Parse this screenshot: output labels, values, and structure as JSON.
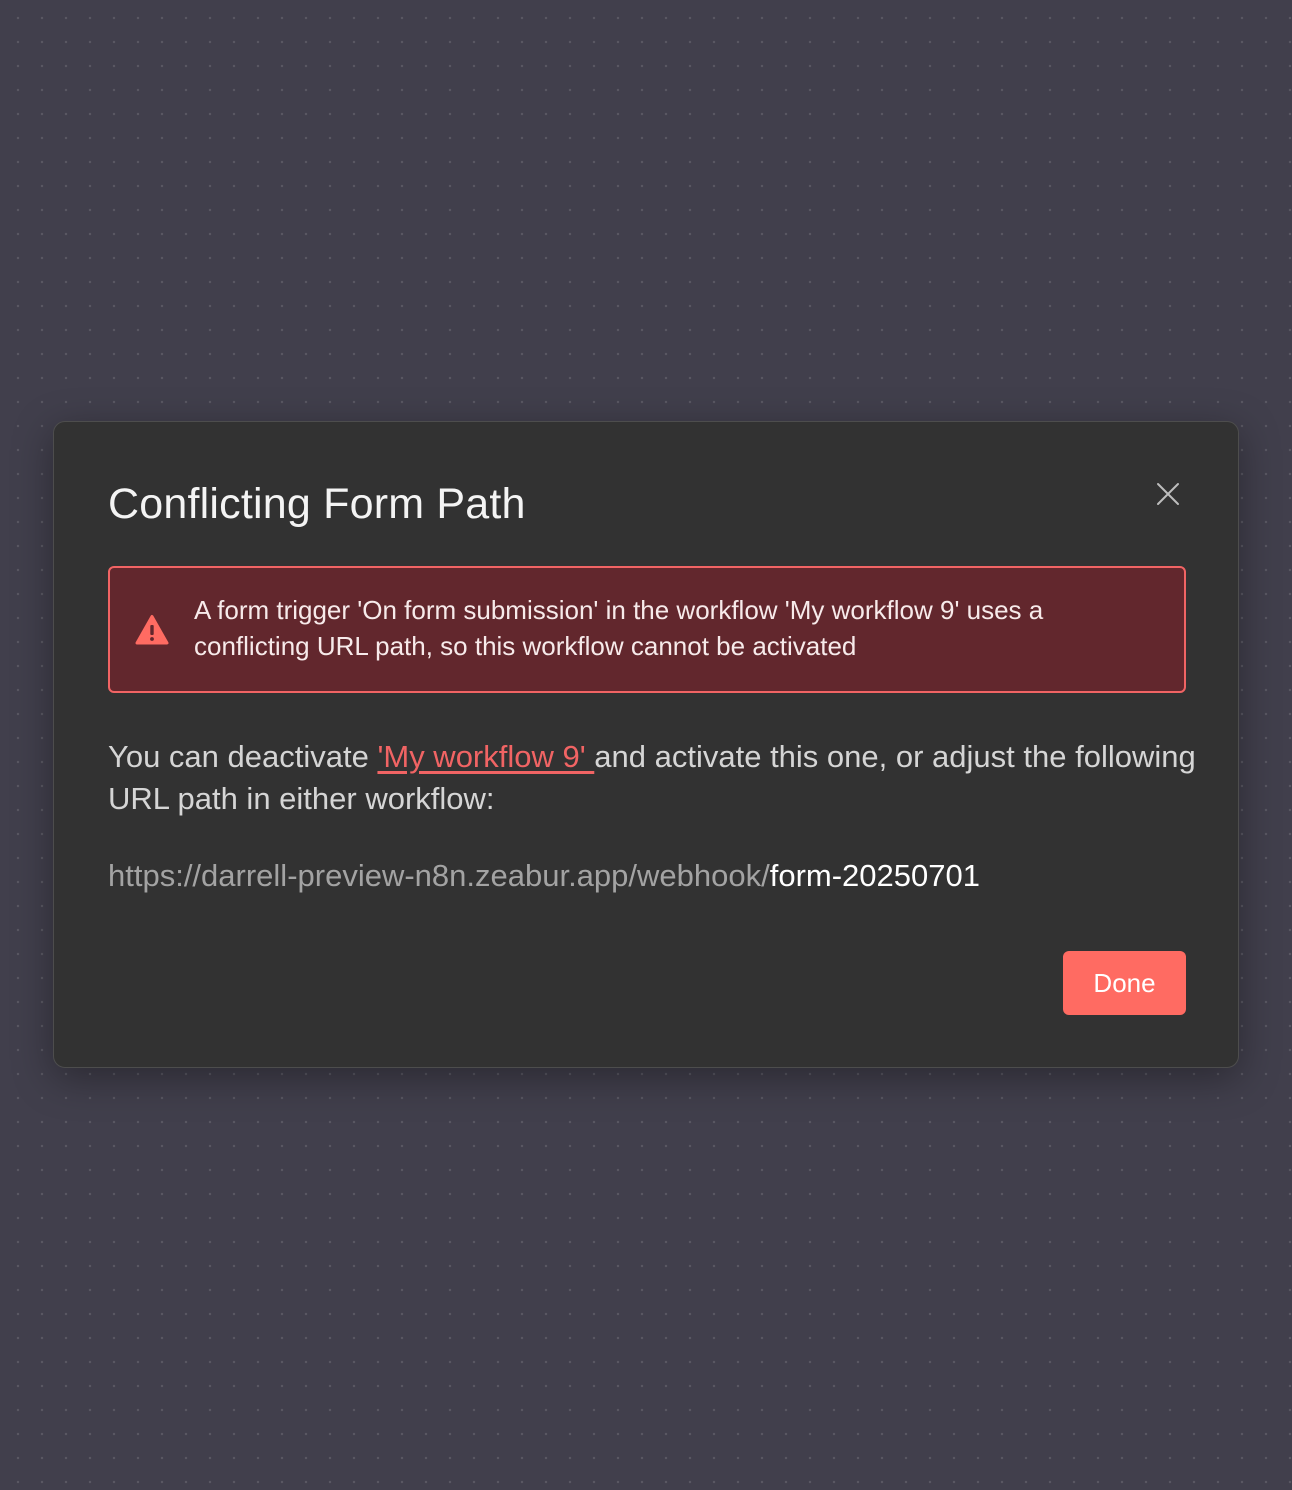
{
  "dialog": {
    "title": "Conflicting Form Path",
    "close_icon": "close-icon",
    "alert": {
      "icon": "warning-triangle-icon",
      "message": "A form trigger 'On form submission' in the workflow 'My workflow 9' uses a conflicting URL path, so this workflow cannot be activated"
    },
    "body": {
      "prefix": "You can deactivate ",
      "workflow_link": "'My workflow 9' ",
      "suffix": "and activate this one, or adjust the following URL path in either workflow:"
    },
    "url": {
      "base": "https://darrell-preview-n8n.zeabur.app/webhook/",
      "path": "form-20250701"
    },
    "done_label": "Done"
  },
  "colors": {
    "canvas_background": "#413f4c",
    "modal_background": "#323232",
    "alert_background": "#62272d",
    "alert_border": "#f16464",
    "accent": "#ff6b62"
  }
}
